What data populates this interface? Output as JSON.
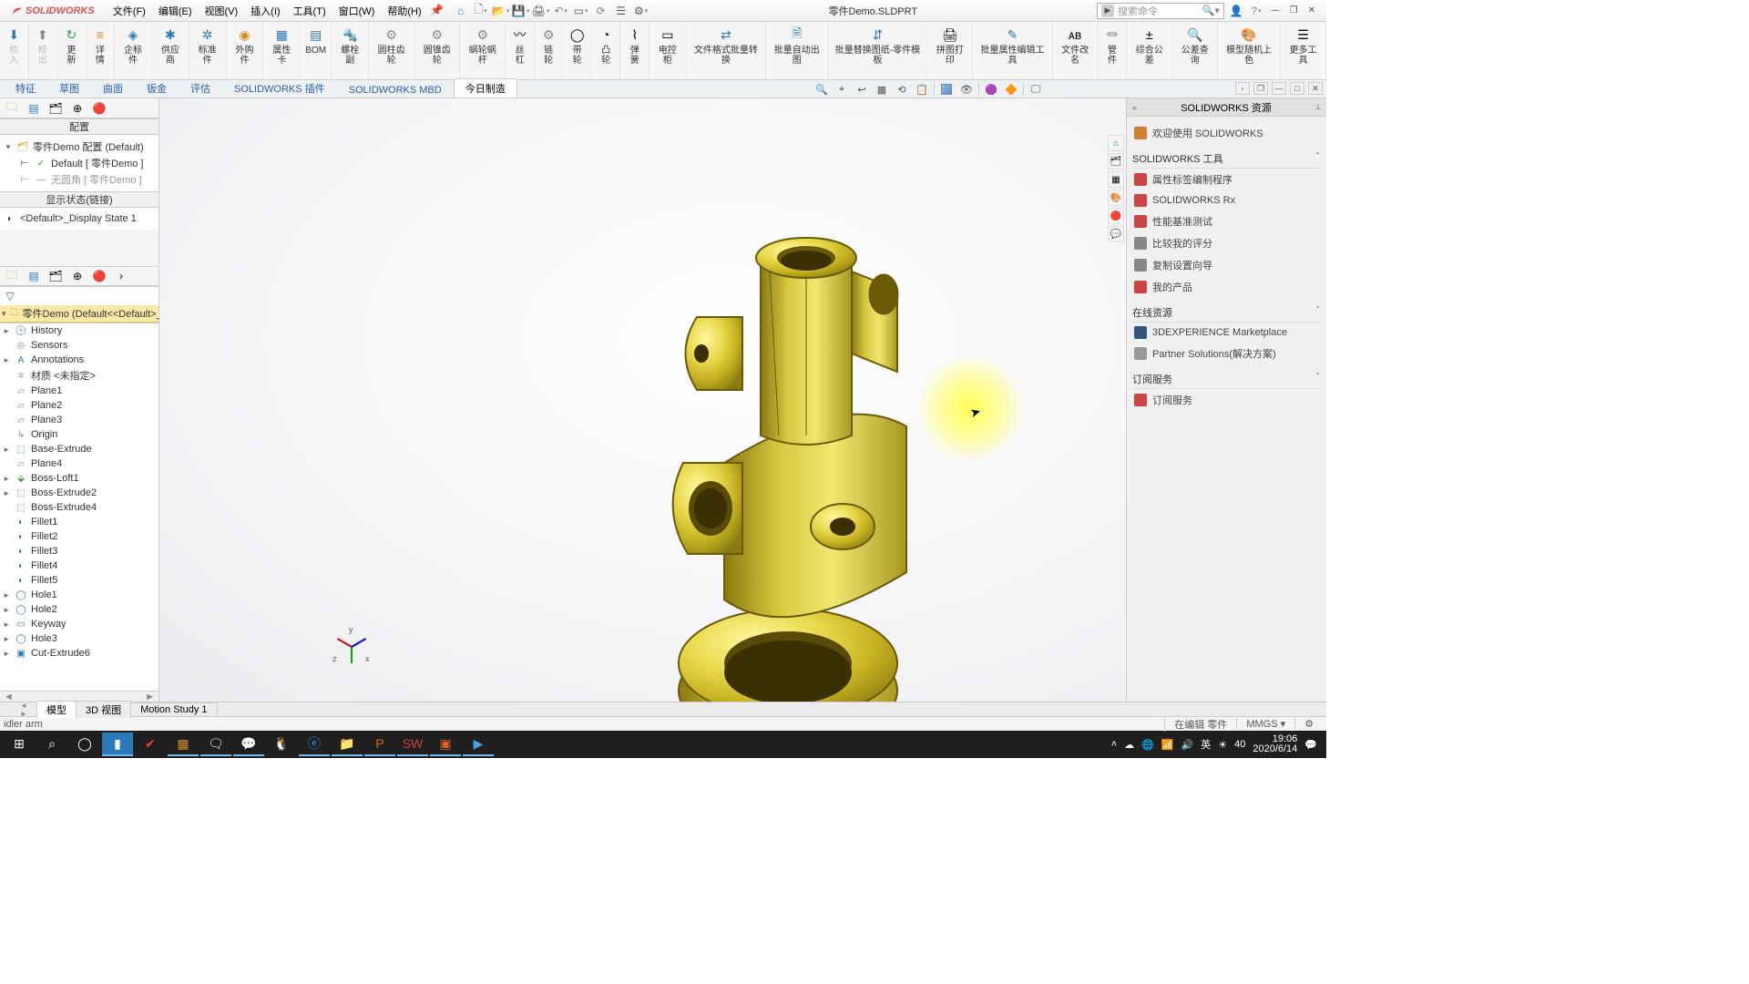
{
  "app": {
    "name": "SOLIDWORKS",
    "document": "零件Demo.SLDPRT"
  },
  "menus": [
    "文件(F)",
    "编辑(E)",
    "视图(V)",
    "插入(I)",
    "工具(T)",
    "窗口(W)",
    "帮助(H)"
  ],
  "search": {
    "placeholder": "搜索命令"
  },
  "ribbon": [
    {
      "label": "检入"
    },
    {
      "label": "检出"
    },
    {
      "label": "更新"
    },
    {
      "label": "详情"
    },
    {
      "label": "企标件"
    },
    {
      "label": "供应商"
    },
    {
      "label": "标准件"
    },
    {
      "label": "外购件"
    },
    {
      "label": "属性卡"
    },
    {
      "label": "BOM"
    },
    {
      "label": "螺栓副"
    },
    {
      "label": "圆柱齿轮"
    },
    {
      "label": "圆锥齿轮"
    },
    {
      "label": "蜗轮蜗杆"
    },
    {
      "label": "丝杠"
    },
    {
      "label": "链轮"
    },
    {
      "label": "带轮"
    },
    {
      "label": "凸轮"
    },
    {
      "label": "弹簧"
    },
    {
      "label": "电控柜"
    },
    {
      "label": "文件格式批量转换"
    },
    {
      "label": "批量自动出图"
    },
    {
      "label": "批量替换图纸-零件模板"
    },
    {
      "label": "拼图打印"
    },
    {
      "label": "批量属性编辑工具"
    },
    {
      "label": "文件改名"
    },
    {
      "label": "管件"
    },
    {
      "label": "综合公差"
    },
    {
      "label": "公差查询"
    },
    {
      "label": "模型随机上色"
    },
    {
      "label": "更多工具"
    }
  ],
  "tabs": [
    "特征",
    "草图",
    "曲面",
    "钣金",
    "评估",
    "SOLIDWORKS 插件",
    "SOLIDWORKS MBD",
    "今日制造"
  ],
  "config": {
    "title": "配置",
    "root": "零件Demo 配置  (Default)",
    "default": "Default [ 零件Demo ]",
    "nohorn": "无圆角 [ 零件Demo ]",
    "dispTitle": "显示状态(链接)",
    "dispState": "<Default>_Display State 1"
  },
  "treeRoot": "零件Demo  (Default<<Default>_",
  "features": [
    "History",
    "Sensors",
    "Annotations",
    "材质 <未指定>",
    "Plane1",
    "Plane2",
    "Plane3",
    "Origin",
    "Base-Extrude",
    "Plane4",
    "Boss-Loft1",
    "Boss-Extrude2",
    "Boss-Extrude4",
    "Fillet1",
    "Fillet2",
    "Fillet3",
    "Fillet4",
    "Fillet5",
    "Hole1",
    "Hole2",
    "Keyway",
    "Hole3",
    "Cut-Extrude6"
  ],
  "modelTabs": [
    "模型",
    "3D 视图",
    "Motion Study 1"
  ],
  "status": {
    "left": "idler arm",
    "edit": "在编辑 零件",
    "units": "MMGS"
  },
  "taskpane": {
    "title": "SOLIDWORKS 资源",
    "welcome": "欢迎使用  SOLIDWORKS",
    "toolsHeader": "SOLIDWORKS 工具",
    "tools": [
      "属性标签编制程序",
      "SOLIDWORKS Rx",
      "性能基准测试",
      "比较我的评分",
      "复制设置向导",
      "我的产品"
    ],
    "onlineHeader": "在线资源",
    "online": [
      "3DEXPERIENCE Marketplace",
      "Partner Solutions(解决方案)"
    ],
    "subHeader": "订阅服务",
    "sub": [
      "订阅服务"
    ]
  },
  "triad": {
    "x": "x",
    "y": "y",
    "z": "z"
  },
  "clock": {
    "time": "19:06",
    "date": "2020/6/14",
    "ime": "英",
    "temp": "40"
  }
}
